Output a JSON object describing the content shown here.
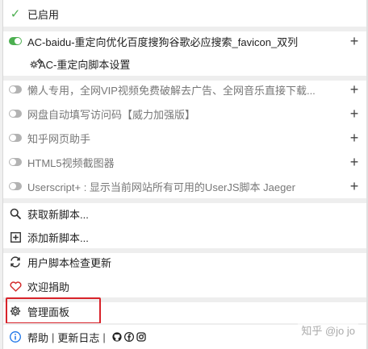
{
  "header": {
    "enabled_label": "已启用"
  },
  "scripts": [
    {
      "name": "AC-baidu-重定向优化百度搜狗谷歌必应搜索_favicon_双列",
      "enabled": true
    },
    {
      "name": "懒人专用，全网VIP视频免费破解去广告、全网音乐直接下载...",
      "enabled": false
    },
    {
      "name": "网盘自动填写访问码【威力加强版】",
      "enabled": false
    },
    {
      "name": "知乎网页助手",
      "enabled": false
    },
    {
      "name": "HTML5视频截图器",
      "enabled": false
    },
    {
      "name": "Userscript+ : 显示当前网站所有可用的UserJS脚本 Jaeger",
      "enabled": false
    }
  ],
  "sub_setting": {
    "label": "AC-重定向脚本设置"
  },
  "actions": {
    "get_new": "获取新脚本...",
    "add_new": "添加新脚本...",
    "check_updates": "用户脚本检查更新",
    "donate": "欢迎捐助",
    "dashboard": "管理面板"
  },
  "footer": {
    "help": "帮助",
    "separator": "|",
    "changelog": "更新日志",
    "separator2": "|"
  },
  "plus_symbol": "+",
  "check_symbol": "✓",
  "watermark": "知乎 @jo jo",
  "colors": {
    "accent_green": "#4caf50",
    "highlight_red": "#d8232a",
    "heart_red": "#d32f2f",
    "info_blue": "#1a73e8"
  }
}
